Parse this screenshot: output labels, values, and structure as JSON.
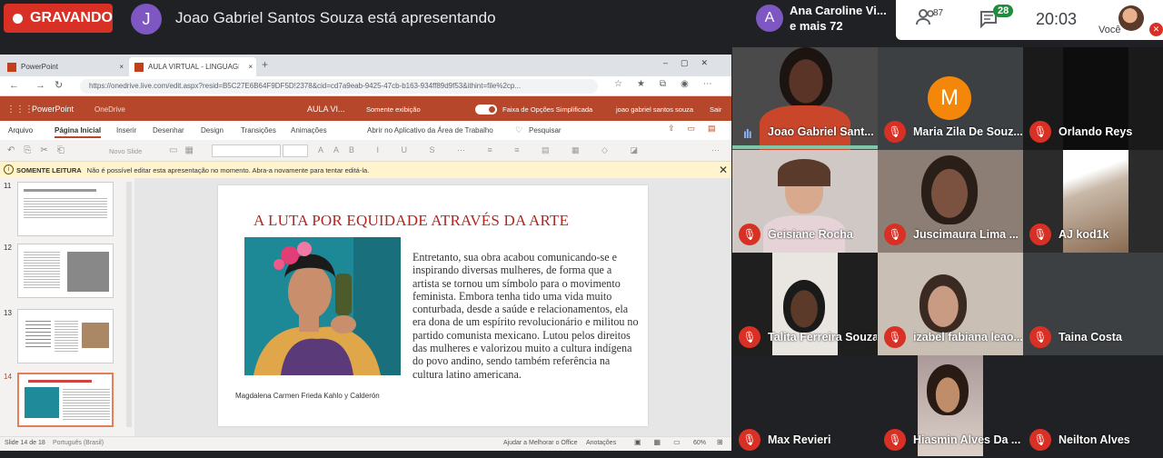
{
  "recording": {
    "label": "GRAVANDO"
  },
  "presenter": {
    "initial": "J",
    "text": "Joao Gabriel Santos Souza está apresentando"
  },
  "meeting": {
    "first_participant_initial": "A",
    "first_participant": "Ana Caroline Vi...",
    "more": "e mais 72",
    "people_count": "87",
    "chat_count": "28",
    "time": "20:03",
    "you_label": "Você"
  },
  "browser": {
    "tabs": [
      "PowerPoint",
      "AULA VIRTUAL - LINGUAGENS 2..."
    ],
    "url": "https://onedrive.live.com/edit.aspx?resid=B5C27E6B64F9DF5D!2378&cid=cd7a9eab-9425-47cb-b163-934ff89d9f53&ithint=file%2cp..."
  },
  "ppt": {
    "app": "PowerPoint",
    "onedrive": "OneDrive",
    "doc_title": "AULA VI...",
    "view_mode": "Somente exibição",
    "simplified": "Faixa de Opções Simplificada",
    "user": "joao gabriel santos souza",
    "signout": "Sair",
    "ribbon_tabs": [
      "Arquivo",
      "Página Inicial",
      "Inserir",
      "Desenhar",
      "Design",
      "Transições",
      "Animações",
      "Abrir no Aplicativo da Área de Trabalho",
      "Pesquisar"
    ],
    "new_slide": "Novo Slide",
    "readonly_label": "SOMENTE LEITURA",
    "readonly_text": "Não é possível editar esta apresentação no momento. Abra-a novamente para tentar editá-la.",
    "thumb_numbers": [
      "11",
      "12",
      "13",
      "14"
    ],
    "status_slide": "Slide 14 de 18",
    "status_lang": "Português (Brasil)",
    "status_help": "Ajudar a Melhorar o Office",
    "status_notes": "Anotações",
    "zoom": "60%"
  },
  "slide": {
    "title": "A LUTA POR EQUIDADE  ATRAVÉS DA ARTE",
    "caption": "Magdalena Carmen Frieda Kahlo y Calderón",
    "body": "Entretanto, sua obra acabou comunicando-se e inspirando diversas mulheres, de forma que a artista se tornou um símbolo para o movimento feminista. Embora tenha tido uma vida muito conturbada, desde a saúde e relacionamentos, ela era dona de um espírito revolucionário e militou no partido comunista mexicano. Lutou pelos direitos das mulheres e valorizou muito a cultura indígena do povo andino, sendo também referência na cultura latino americana."
  },
  "participants": [
    {
      "name": "Joao Gabriel Sant...",
      "status": "speaking"
    },
    {
      "name": "Maria Zila De Souz...",
      "status": "muted",
      "initial": "M"
    },
    {
      "name": "Orlando Reys",
      "status": "muted"
    },
    {
      "name": "Geisiane Rocha",
      "status": "muted"
    },
    {
      "name": "Juscimaura Lima ...",
      "status": "muted"
    },
    {
      "name": "AJ kod1k",
      "status": "muted"
    },
    {
      "name": "Talita Ferreira Souza",
      "status": "muted"
    },
    {
      "name": "izabel fabiana leao...",
      "status": "muted"
    },
    {
      "name": "Taina Costa",
      "status": "muted"
    },
    {
      "name": "Max Revieri",
      "status": "muted"
    },
    {
      "name": "Hiasmin Alves Da ...",
      "status": "muted"
    },
    {
      "name": "Neilton Alves",
      "status": "muted"
    }
  ],
  "colors": {
    "record_red": "#d93025",
    "ppt_orange": "#b7472a",
    "slide_title_red": "#b3261e",
    "chat_green": "#1e8e3e",
    "avatar_orange": "#f4870a"
  }
}
